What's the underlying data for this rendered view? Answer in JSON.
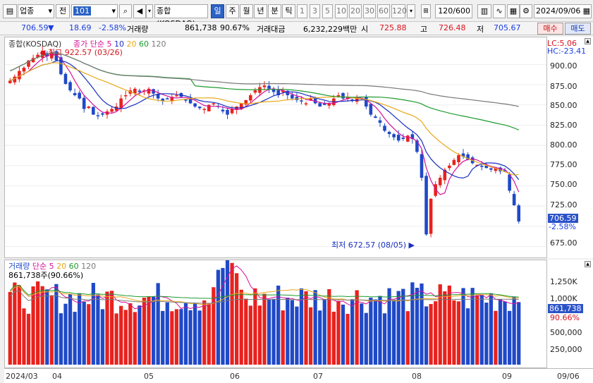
{
  "toolbar": {
    "market": "업종",
    "market_btn": "전",
    "code": "101",
    "index_name": "종합(KOSDAQ)",
    "periods": [
      "일",
      "주",
      "월",
      "년",
      "분",
      "틱"
    ],
    "numbers": [
      "1",
      "3",
      "5",
      "10",
      "20",
      "30",
      "60",
      "120"
    ],
    "count": "120",
    "count_total": "/600",
    "date": "2024/09/06"
  },
  "quote": {
    "price": "706.59",
    "change": "18.69",
    "change_pct": "-2.58%",
    "volume_label": "거래량",
    "volume": "861,738",
    "volume_ratio": "90.67%",
    "amount_label": "거래대금",
    "amount": "6,232,229백만",
    "open_label": "시",
    "open": "725.88",
    "high_label": "고",
    "high": "726.48",
    "low_label": "저",
    "low": "705.67",
    "buy": "매수",
    "sell": "매도"
  },
  "price_panel": {
    "name": "종합(KOSDAQ)",
    "ma_legend": {
      "label": "종가 단순",
      "periods": [
        "5",
        "10",
        "20",
        "60",
        "120"
      ]
    },
    "max_label": "최고 922.57 (03/26)",
    "min_label": "최저 672.57 (08/05)",
    "lc": "LC:5.06",
    "hc": "HC:-23.41",
    "y_ticks": [
      "900.00",
      "875.00",
      "850.00",
      "825.00",
      "800.00",
      "775.00",
      "750.00",
      "725.00",
      "675.00"
    ],
    "current_tag": "706.59",
    "current_pct": "-2.58%"
  },
  "volume_panel": {
    "label": "거래량",
    "ma_legend": {
      "label": "단순",
      "periods": [
        "5",
        "20",
        "60",
        "120"
      ]
    },
    "current": "861,738주(90.66%)",
    "y_ticks": [
      "1,250K",
      "1,000K",
      "750,000",
      "500,000",
      "250,000"
    ],
    "current_tag": "861,738",
    "current_pct": "90.66%"
  },
  "x_axis": [
    "2024/03",
    "04",
    "05",
    "06",
    "07",
    "08",
    "09",
    "09/06"
  ],
  "colors": {
    "up": "#e8221e",
    "down": "#1f49c8",
    "ma5": "#d6119a",
    "ma10": "#1a2fc0",
    "ma20": "#e8a818",
    "ma60": "#1f9a2e",
    "ma120": "#7a7a7a"
  },
  "chart_data": {
    "type": "candlestick",
    "dates": [
      "03/15",
      "03/18",
      "03/19",
      "03/20",
      "03/21",
      "03/22",
      "03/25",
      "03/26",
      "03/27",
      "03/28",
      "03/29",
      "04/01",
      "04/02",
      "04/03",
      "04/04",
      "04/05",
      "04/08",
      "04/09",
      "04/11",
      "04/12",
      "04/15",
      "04/16",
      "04/17",
      "04/18",
      "04/19",
      "04/22",
      "04/23",
      "04/24",
      "04/25",
      "04/26",
      "04/29",
      "04/30",
      "05/02",
      "05/03",
      "05/07",
      "05/08",
      "05/09",
      "05/10",
      "05/13",
      "05/14",
      "05/16",
      "05/17",
      "05/20",
      "05/21",
      "05/22",
      "05/23",
      "05/24",
      "05/27",
      "05/28",
      "05/29",
      "05/30",
      "05/31",
      "06/03",
      "06/04",
      "06/05",
      "06/07",
      "06/10",
      "06/11",
      "06/12",
      "06/13",
      "06/14",
      "06/17",
      "06/18",
      "06/19",
      "06/20",
      "06/21",
      "06/24",
      "06/25",
      "06/26",
      "06/27",
      "06/28",
      "07/01",
      "07/02",
      "07/03",
      "07/04",
      "07/05",
      "07/08",
      "07/09",
      "07/10",
      "07/11",
      "07/12",
      "07/15",
      "07/16",
      "07/17",
      "07/18",
      "07/19",
      "07/22",
      "07/23",
      "07/24",
      "07/25",
      "07/26",
      "07/29",
      "07/30",
      "07/31",
      "08/01",
      "08/02",
      "08/05",
      "08/06",
      "08/07",
      "08/08",
      "08/09",
      "08/12",
      "08/13",
      "08/14",
      "08/16",
      "08/19",
      "08/20",
      "08/21",
      "08/22",
      "08/23",
      "08/26",
      "08/27",
      "08/28",
      "08/29",
      "08/30",
      "09/02",
      "09/03",
      "09/04",
      "09/05",
      "09/06"
    ],
    "close": [
      880,
      885,
      892,
      896,
      905,
      908,
      912,
      917,
      910,
      915,
      905,
      888,
      876,
      868,
      862,
      858,
      845,
      848,
      838,
      836,
      838,
      842,
      845,
      848,
      858,
      862,
      868,
      870,
      866,
      868,
      870,
      864,
      858,
      855,
      858,
      860,
      862,
      860,
      856,
      852,
      848,
      846,
      845,
      850,
      852,
      848,
      842,
      838,
      845,
      848,
      852,
      856,
      862,
      868,
      872,
      874,
      870,
      866,
      862,
      868,
      862,
      858,
      856,
      855,
      852,
      858,
      852,
      848,
      850,
      852,
      858,
      862,
      858,
      860,
      856,
      860,
      858,
      848,
      838,
      834,
      828,
      818,
      814,
      810,
      806,
      808,
      812,
      808,
      792,
      760,
      690,
      734,
      752,
      760,
      770,
      775,
      782,
      788,
      786,
      782,
      778,
      776,
      774,
      772,
      770,
      772,
      768,
      768,
      744,
      726,
      706
    ],
    "ylim": [
      665,
      930
    ],
    "volume_ylim": [
      0,
      1400000
    ],
    "volume_ma": [
      "5",
      "20",
      "60",
      "120"
    ],
    "price_ma": [
      "5",
      "10",
      "20",
      "60",
      "120"
    ]
  }
}
